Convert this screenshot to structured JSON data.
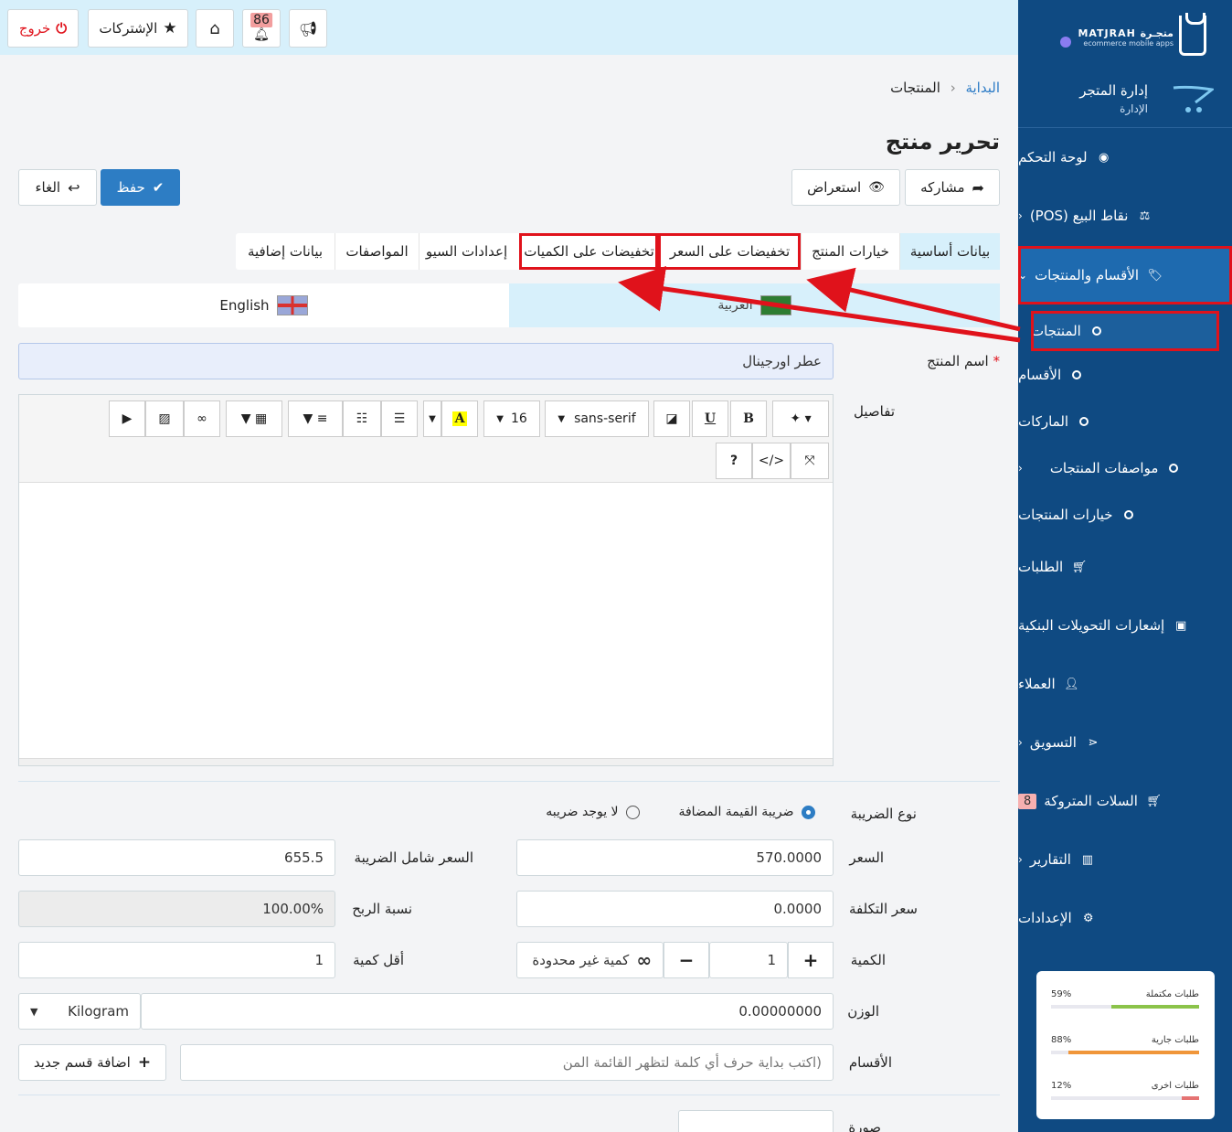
{
  "topbar": {
    "logout": "خروج",
    "subscriptions": "الإشتركات",
    "notifications_count": "86"
  },
  "sidebar": {
    "brand": "MATJRAH متجـرة",
    "brand_sub": "ecommerce mobile apps",
    "store_title": "إدارة المتجر",
    "store_sub": "الإدارة",
    "items": [
      {
        "label": "لوحة التحكم"
      },
      {
        "label": "نقاط البيع (POS)"
      },
      {
        "label": "الأقسام والمنتجات"
      },
      {
        "label": "المنتجات"
      },
      {
        "label": "الأقسام"
      },
      {
        "label": "الماركات"
      },
      {
        "label": "مواصفات المنتجات"
      },
      {
        "label": "خيارات المنتجات"
      },
      {
        "label": "الطلبات"
      },
      {
        "label": "إشعارات التحويلات البنكية"
      },
      {
        "label": "العملاء"
      },
      {
        "label": "التسويق"
      },
      {
        "label": "السلات المتروكة",
        "badge": "8"
      },
      {
        "label": "التقارير"
      },
      {
        "label": "الإعدادات"
      }
    ],
    "stats": [
      {
        "label": "طلبات مكتملة",
        "pct": "59%",
        "value": 59,
        "color": "#8bc34a"
      },
      {
        "label": "طلبات جارية",
        "pct": "88%",
        "value": 88,
        "color": "#f0963a"
      },
      {
        "label": "طلبات اخرى",
        "pct": "12%",
        "value": 12,
        "color": "#e57373"
      }
    ]
  },
  "breadcrumb": {
    "home": "البداية",
    "current": "المنتجات"
  },
  "page_title": "تحرير منتج",
  "actions": {
    "share": "مشاركه",
    "preview": "استعراض",
    "save": "حفظ",
    "cancel": "الغاء"
  },
  "tabs": [
    "بيانات أساسية",
    "خيارات المنتج",
    "تخفيضات على السعر",
    "تخفيضات على الكميات",
    "إعدادات السيو",
    "المواصفات",
    "بيانات إضافية"
  ],
  "languages": {
    "ar": "العربية",
    "en": "English"
  },
  "form": {
    "product_name_label": "اسم المنتج",
    "product_name_value": "عطر اورجينال",
    "details_label": "تفاصيل",
    "editor": {
      "font": "sans-serif",
      "size": "16"
    },
    "tax_type_label": "نوع الضريبة",
    "tax_vat": "ضريبة القيمة المضافة",
    "tax_none": "لا يوجد ضريبه",
    "price_label": "السعر",
    "price_value": "570.0000",
    "price_incl_label": "السعر شامل الضريبة",
    "price_incl_value": "655.5",
    "cost_label": "سعر التكلفة",
    "cost_value": "0.0000",
    "profit_label": "نسبة الربح",
    "profit_value": "100.00%",
    "qty_label": "الكمية",
    "qty_value": "1",
    "unlimited": "كمية غير محدودة",
    "min_qty_label": "أقل كمية",
    "min_qty_value": "1",
    "weight_label": "الوزن",
    "weight_value": "0.00000000",
    "weight_unit": "Kilogram",
    "categories_label": "الأقسام",
    "categories_placeholder": "(اكتب بداية حرف أي كلمة لتظهر القائمة المن",
    "add_category": "اضافة قسم جديد",
    "image_label": "صورة"
  }
}
